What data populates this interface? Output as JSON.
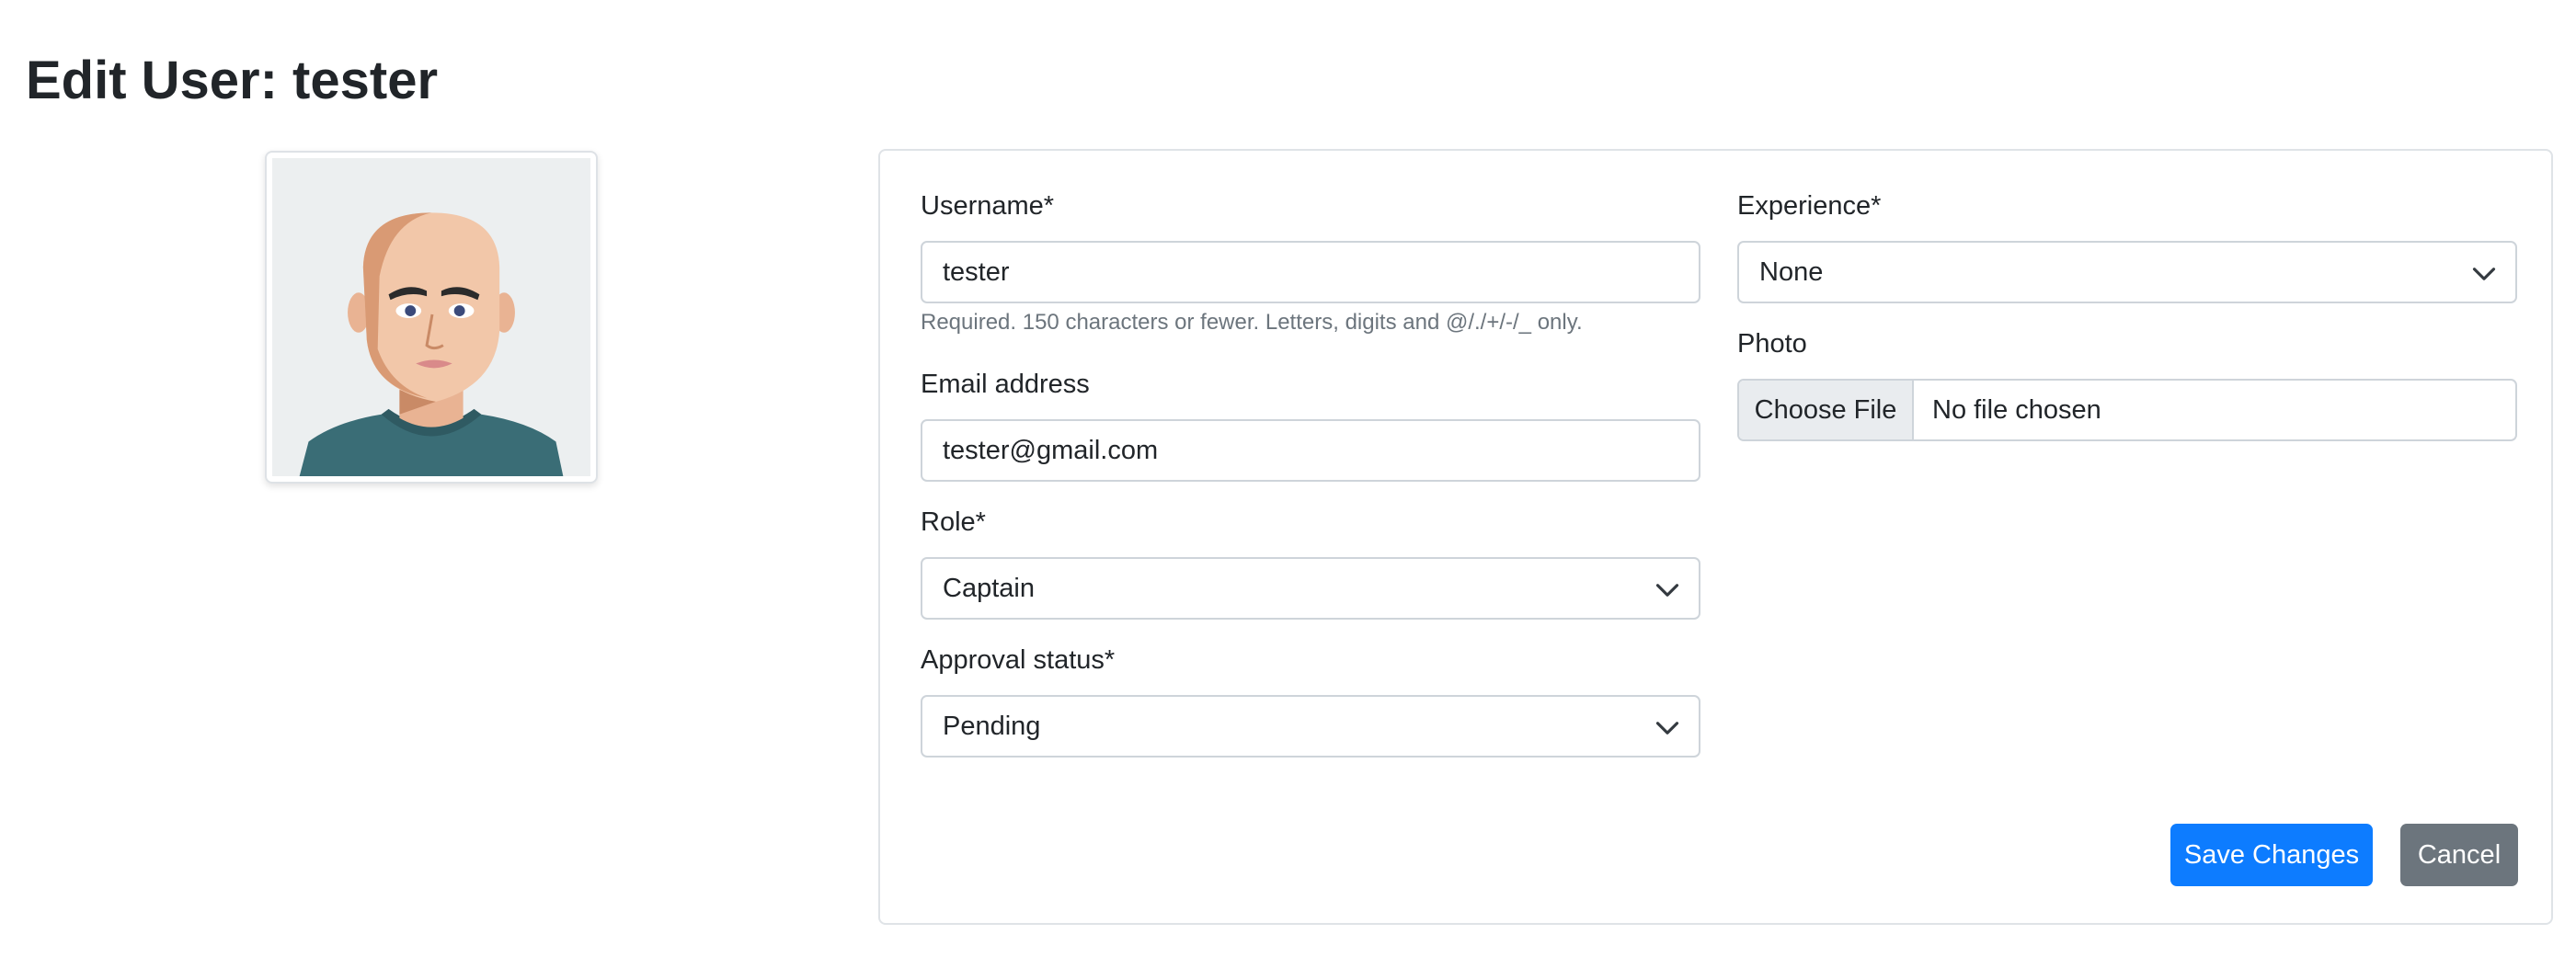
{
  "page": {
    "title": "Edit User: tester"
  },
  "form": {
    "username": {
      "label": "Username*",
      "value": "tester",
      "help": "Required. 150 characters or fewer. Letters, digits and @/./+/-/_ only."
    },
    "email": {
      "label": "Email address",
      "value": "tester@gmail.com"
    },
    "role": {
      "label": "Role*",
      "selected": "Captain"
    },
    "approval_status": {
      "label": "Approval status*",
      "selected": "Pending"
    },
    "experience": {
      "label": "Experience*",
      "selected": "None"
    },
    "photo": {
      "label": "Photo",
      "button_label": "Choose File",
      "status": "No file chosen"
    }
  },
  "actions": {
    "save_label": "Save Changes",
    "cancel_label": "Cancel"
  },
  "colors": {
    "primary": "#0d7cff",
    "secondary": "#6c757d",
    "border": "#ced4da"
  },
  "icons": {
    "select_arrow": "chevron-down-icon",
    "avatar": "user-avatar-illustration"
  }
}
